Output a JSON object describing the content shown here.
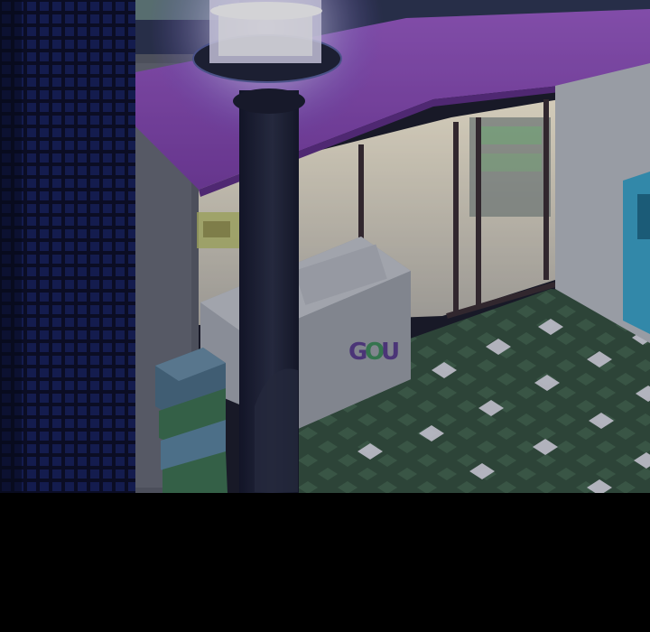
{
  "scene": {
    "description_free": true,
    "store_logo": {
      "text": "GOU",
      "letters": [
        "G",
        "O",
        "U"
      ],
      "letter_colors": [
        "#5a3f8c",
        "#3f8c5a",
        "#5a3f8c"
      ]
    },
    "colors": {
      "awning": "#8a4fb4",
      "awning_dark": "#5e2f86",
      "lamp_glow": "#e9e6ff",
      "lamp_post": "#1e2232",
      "tile_wall": "#13173a",
      "tile_grid": "#1f3a8a",
      "pavement": "#3a5a44",
      "pavement_dot": "#e8e6f2",
      "freezer": "#9aa0a8",
      "crate_blue": "#4c6f87",
      "crate_green": "#3e7351",
      "store_interior": "#f2efe6"
    }
  }
}
